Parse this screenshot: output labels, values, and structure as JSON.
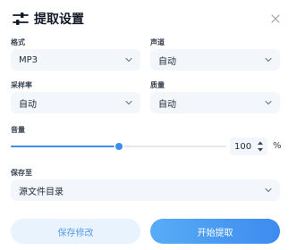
{
  "dialog": {
    "title": "提取设置",
    "icons": {
      "title": "sliders-icon",
      "close": "close-icon"
    }
  },
  "fields": {
    "format": {
      "label": "格式",
      "value": "MP3"
    },
    "channel": {
      "label": "声道",
      "value": "自动"
    },
    "sample_rate": {
      "label": "采样率",
      "value": "自动"
    },
    "quality": {
      "label": "质量",
      "value": "自动"
    },
    "volume": {
      "label": "音量",
      "value": "100",
      "unit": "%",
      "slider_fraction": 0.5
    },
    "save_to": {
      "label": "保存至",
      "value": "源文件目录"
    }
  },
  "buttons": {
    "save": "保存修改",
    "start": "开始提取"
  },
  "colors": {
    "accent": "#3b8ef0",
    "field_bg": "#f3f6fb",
    "save_button_bg": "#e9f3fd"
  }
}
